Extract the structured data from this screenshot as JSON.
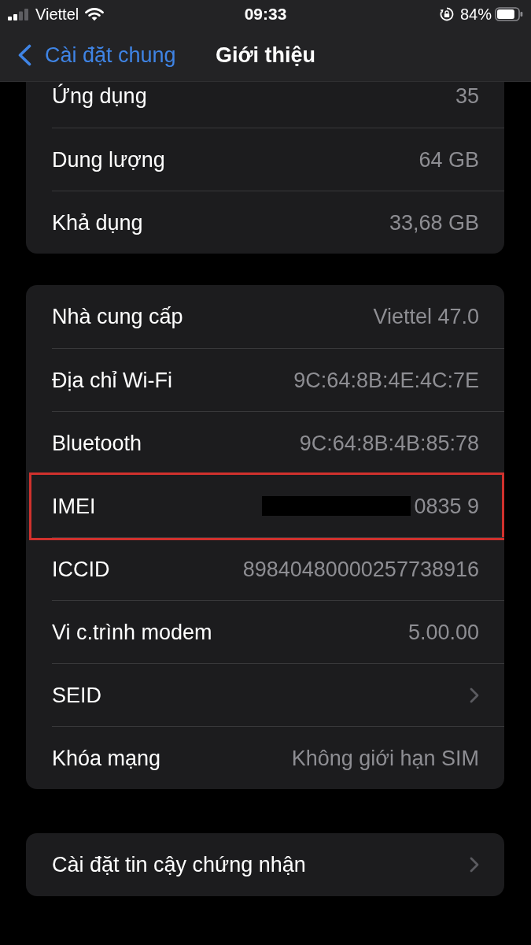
{
  "status_bar": {
    "carrier": "Viettel",
    "time": "09:33",
    "battery": "84%"
  },
  "nav_bar": {
    "back_label": "Cài đặt chung",
    "title": "Giới thiệu"
  },
  "groups": [
    {
      "rows": [
        {
          "kind": "value",
          "label": "Ứng dụng",
          "value": "35",
          "highlighted": false,
          "redacted": false
        },
        {
          "kind": "value",
          "label": "Dung lượng",
          "value": "64 GB",
          "highlighted": false,
          "redacted": false
        },
        {
          "kind": "value",
          "label": "Khả dụng",
          "value": "33,68 GB",
          "highlighted": false,
          "redacted": false
        }
      ]
    },
    {
      "rows": [
        {
          "kind": "value",
          "label": "Nhà cung cấp",
          "value": "Viettel 47.0",
          "highlighted": false,
          "redacted": false
        },
        {
          "kind": "value",
          "label": "Địa chỉ Wi-Fi",
          "value": "9C:64:8B:4E:4C:7E",
          "highlighted": false,
          "redacted": false
        },
        {
          "kind": "value",
          "label": "Bluetooth",
          "value": "9C:64:8B:4B:85:78",
          "highlighted": false,
          "redacted": false
        },
        {
          "kind": "value",
          "label": "IMEI",
          "value": "0835 9",
          "highlighted": true,
          "redacted": true
        },
        {
          "kind": "value",
          "label": "ICCID",
          "value": "89840480000257738916",
          "highlighted": false,
          "redacted": false
        },
        {
          "kind": "value",
          "label": "Vi c.trình modem",
          "value": "5.00.00",
          "highlighted": false,
          "redacted": false
        },
        {
          "kind": "link",
          "label": "SEID",
          "highlighted": false,
          "redacted": false
        },
        {
          "kind": "value",
          "label": "Khóa mạng",
          "value": "Không giới hạn SIM",
          "highlighted": false,
          "redacted": false
        }
      ]
    },
    {
      "rows": [
        {
          "kind": "link",
          "label": "Cài đặt tin cậy chứng nhận",
          "highlighted": false,
          "redacted": false
        }
      ]
    }
  ]
}
